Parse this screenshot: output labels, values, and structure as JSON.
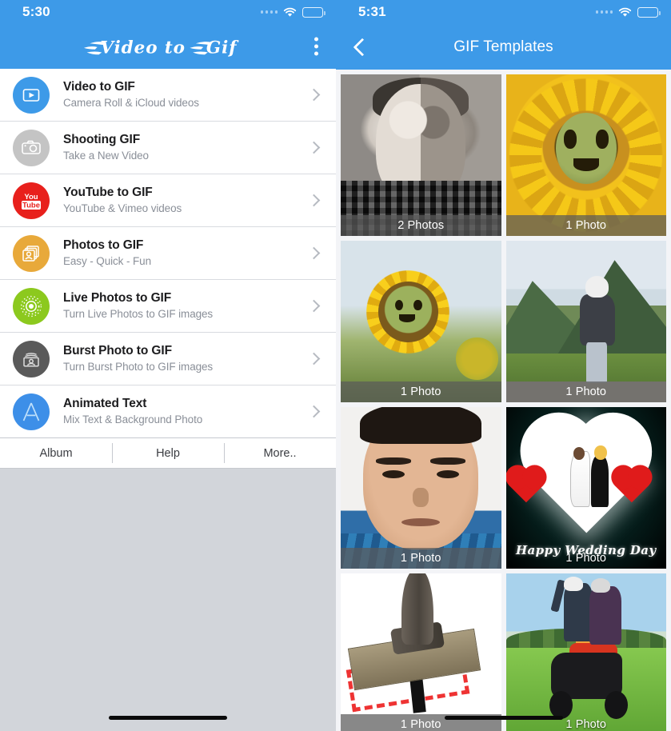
{
  "left_phone": {
    "status_bar": {
      "time": "5:30",
      "signal_icon": "signal-dots-icon",
      "wifi_icon": "wifi-icon",
      "battery_icon": "battery-full-icon"
    },
    "nav": {
      "title": "Video to Gif",
      "title_style": "flame-script-logo",
      "overflow_icon": "kebab-menu-icon"
    },
    "menu_items": [
      {
        "title": "Video to GIF",
        "subtitle": "Camera Roll & iCloud videos",
        "icon": "video-play-icon",
        "icon_color": "#3d9ae8",
        "chevron": "chevron-right-icon"
      },
      {
        "title": "Shooting GIF",
        "subtitle": "Take a New Video",
        "icon": "camera-icon",
        "icon_color": "#c4c4c4",
        "chevron": "chevron-right-icon"
      },
      {
        "title": "YouTube to GIF",
        "subtitle": "YouTube & Vimeo videos",
        "icon": "youtube-icon",
        "icon_color": "#e8201c",
        "chevron": "chevron-right-icon"
      },
      {
        "title": "Photos to GIF",
        "subtitle": "Easy - Quick - Fun",
        "icon": "photo-stack-icon",
        "icon_color": "#e8a93a",
        "chevron": "chevron-right-icon"
      },
      {
        "title": "Live Photos to GIF",
        "subtitle": "Turn Live Photos to GIF images",
        "icon": "live-photo-icon",
        "icon_color": "#8cc91e",
        "chevron": "chevron-right-icon"
      },
      {
        "title": "Burst Photo to GIF",
        "subtitle": "Turn Burst Photo to GIF images",
        "icon": "burst-photo-icon",
        "icon_color": "#5a5a5a",
        "chevron": "chevron-right-icon"
      },
      {
        "title": "Animated Text",
        "subtitle": "Mix Text & Background Photo",
        "icon": "letter-a-icon",
        "icon_color": "#3d8fe8",
        "chevron": "chevron-right-icon"
      }
    ],
    "tabs": [
      {
        "label": "Album"
      },
      {
        "label": "Help"
      },
      {
        "label": "More.."
      }
    ]
  },
  "right_phone": {
    "status_bar": {
      "time": "5:31",
      "signal_icon": "signal-dots-icon",
      "wifi_icon": "wifi-icon",
      "battery_icon": "battery-full-icon"
    },
    "nav": {
      "title": "GIF Templates",
      "back_icon": "chevron-left-icon"
    },
    "templates": [
      {
        "caption": "2 Photos",
        "art": "portrait-black-and-white"
      },
      {
        "caption": "1 Photo",
        "art": "sunflower-closeup-smiley"
      },
      {
        "caption": "1 Photo",
        "art": "sunflower-field-smiley"
      },
      {
        "caption": "1 Photo",
        "art": "person-mountain-landscape"
      },
      {
        "caption": "1 Photo",
        "art": "selfie-portrait-blue-shirt"
      },
      {
        "caption": "1 Photo",
        "art": "wedding-heart",
        "overlay_text": "Happy Wedding Day"
      },
      {
        "caption": "1 Photo",
        "art": "rubber-stamp"
      },
      {
        "caption": "1 Photo",
        "art": "two-riders-scooter-field"
      }
    ]
  },
  "theme": {
    "accent_blue": "#3d9ae8",
    "page_background": "#eceef2",
    "list_background": "#ffffff",
    "caption_background": "rgba(90,90,90,0.72)"
  }
}
